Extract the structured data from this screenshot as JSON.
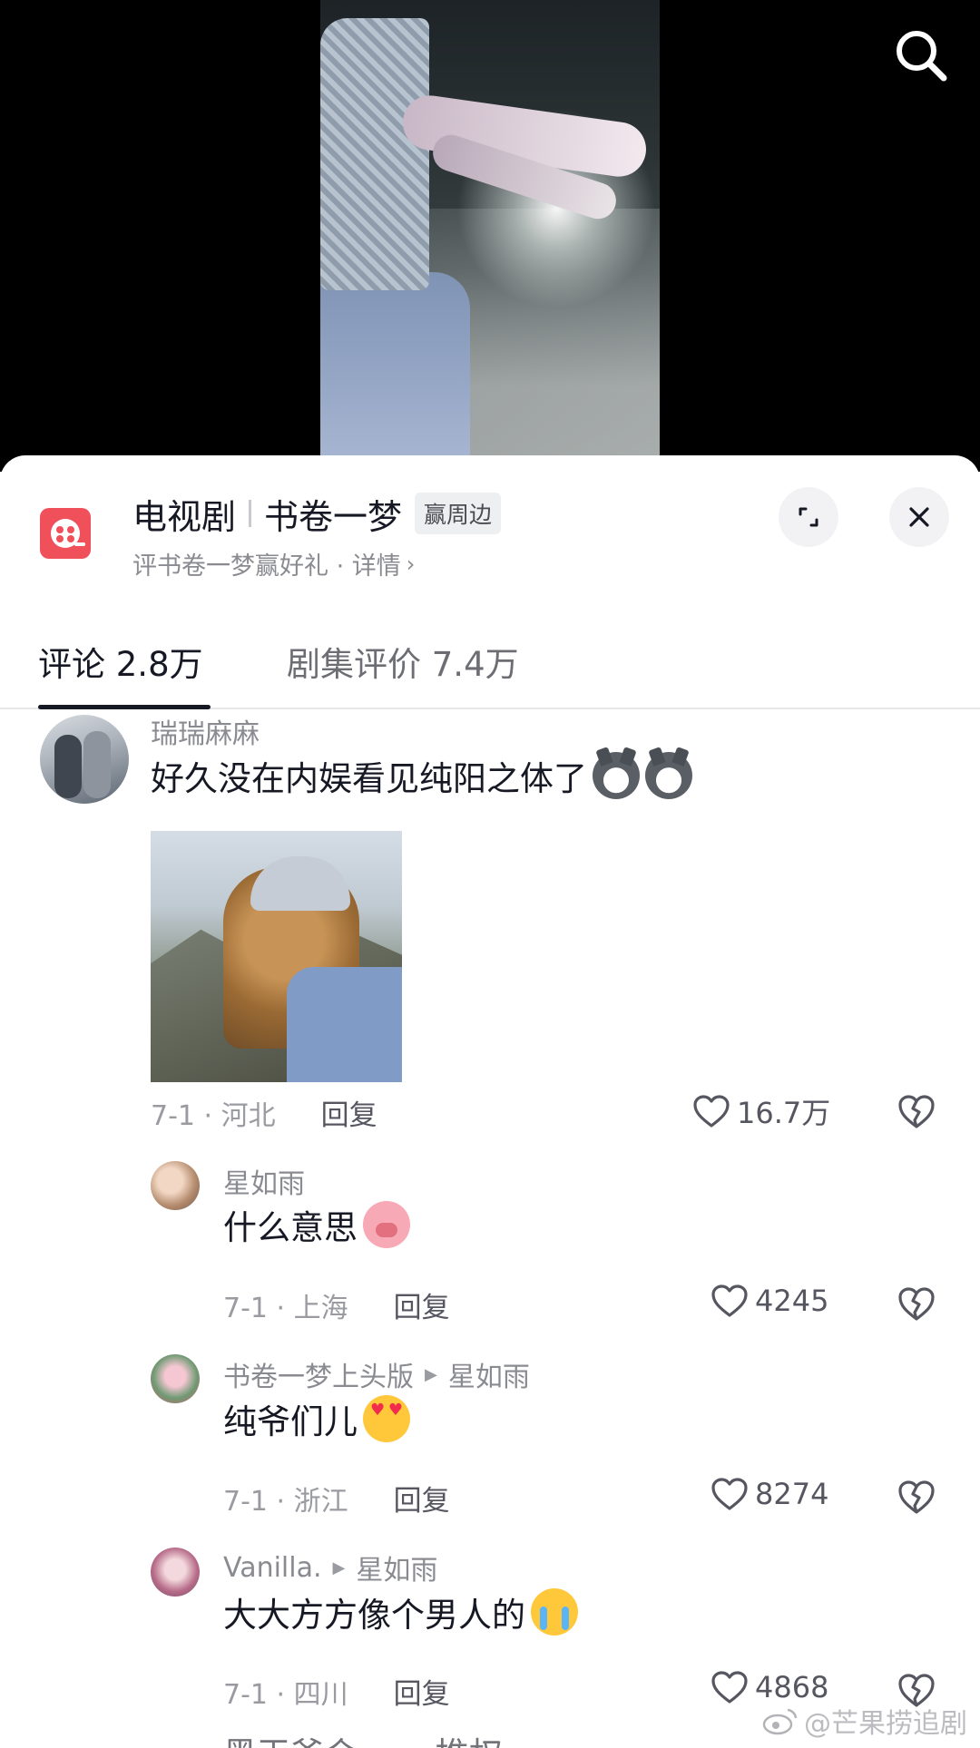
{
  "header": {
    "category": "电视剧",
    "show_name": "书卷一梦",
    "badge": "赢周边",
    "subtitle": "评书卷一梦赢好礼 · 详情",
    "subtitle_chevron": "›"
  },
  "tabs": [
    {
      "label": "评论 2.8万",
      "active": true
    },
    {
      "label": "剧集评价 7.4万",
      "active": false
    }
  ],
  "comments": [
    {
      "user": "瑞瑞麻麻",
      "text": "好久没在内娱看见纯阳之体了",
      "emojis": [
        "wolf-emoji",
        "wolf-emoji"
      ],
      "has_image": true,
      "date_loc": "7-1 · 河北",
      "reply": "回复",
      "likes": "16.7万"
    }
  ],
  "replies": [
    {
      "user": "星如雨",
      "reply_to": "",
      "text": "什么意思",
      "emoji": "pig-emoji",
      "date_loc": "7-1 · 上海",
      "reply": "回复",
      "likes": "4245"
    },
    {
      "user": "书卷一梦上头版",
      "reply_to": "星如雨",
      "text": "纯爷们儿",
      "emoji": "heart-eyes-emoji",
      "date_loc": "7-1 · 浙江",
      "reply": "回复",
      "likes": "8274"
    },
    {
      "user": "Vanilla.",
      "reply_to": "星如雨",
      "text": "大大方方像个男人的",
      "emoji": "crying-emoji",
      "date_loc": "7-1 · 四川",
      "reply": "回复",
      "likes": "4868"
    }
  ],
  "cutoff_text": "黑王爷会…… 推权",
  "watermark": "@芒果捞追剧",
  "colors": {
    "logo": "#f0505a",
    "text": "#161823",
    "muted": "#8a8b91"
  }
}
